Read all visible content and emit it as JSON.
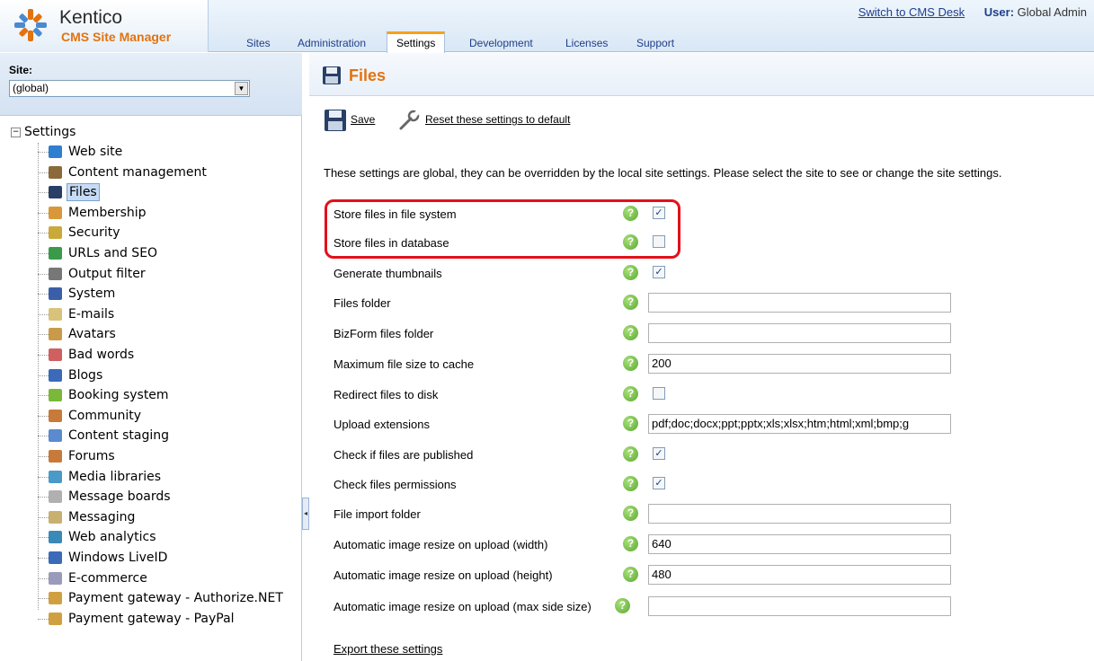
{
  "header": {
    "logo_title": "Kentico",
    "logo_subtitle": "CMS Site Manager",
    "switch_link": "Switch to CMS Desk",
    "user_label": "User:",
    "user_name": "Global Admin",
    "tabs": [
      {
        "label": "Sites"
      },
      {
        "label": "Administration"
      },
      {
        "label": "Settings"
      },
      {
        "label": "Development"
      },
      {
        "label": "Licenses"
      },
      {
        "label": "Support"
      }
    ],
    "active_tab": "Settings"
  },
  "site_selector": {
    "label": "Site:",
    "value": "(global)"
  },
  "tree": {
    "root": "Settings",
    "items": [
      {
        "label": "Web site",
        "icon": "globe-icon",
        "color": "#2f7fd0"
      },
      {
        "label": "Content management",
        "icon": "pen-icon",
        "color": "#8a6a3a"
      },
      {
        "label": "Files",
        "icon": "floppy-disk-icon",
        "color": "#2a3f66"
      },
      {
        "label": "Membership",
        "icon": "user-icon",
        "color": "#d8983a"
      },
      {
        "label": "Security",
        "icon": "key-icon",
        "color": "#c9a93a"
      },
      {
        "label": "URLs and SEO",
        "icon": "network-icon",
        "color": "#3a9a4a"
      },
      {
        "label": "Output filter",
        "icon": "filter-icon",
        "color": "#777777"
      },
      {
        "label": "System",
        "icon": "computer-icon",
        "color": "#3a5fa8"
      },
      {
        "label": "E-mails",
        "icon": "envelope-icon",
        "color": "#d9c27a"
      },
      {
        "label": "Avatars",
        "icon": "avatar-icon",
        "color": "#c89a4a"
      },
      {
        "label": "Bad words",
        "icon": "forbidden-icon",
        "color": "#d06060"
      },
      {
        "label": "Blogs",
        "icon": "book-icon",
        "color": "#3a6ab8"
      },
      {
        "label": "Booking system",
        "icon": "calendar-icon",
        "color": "#7ab83a"
      },
      {
        "label": "Community",
        "icon": "group-icon",
        "color": "#c87a3a"
      },
      {
        "label": "Content staging",
        "icon": "staging-icon",
        "color": "#5a8ad0"
      },
      {
        "label": "Forums",
        "icon": "forum-icon",
        "color": "#c87a3a"
      },
      {
        "label": "Media libraries",
        "icon": "media-icon",
        "color": "#4a9ac8"
      },
      {
        "label": "Message boards",
        "icon": "board-icon",
        "color": "#b0b0b0"
      },
      {
        "label": "Messaging",
        "icon": "envelope-icon",
        "color": "#c8b070"
      },
      {
        "label": "Web analytics",
        "icon": "analytics-icon",
        "color": "#3a8ab8"
      },
      {
        "label": "Windows LiveID",
        "icon": "liveid-icon",
        "color": "#3a6ab8"
      },
      {
        "label": "E-commerce",
        "icon": "cart-icon",
        "color": "#9a9aba"
      },
      {
        "label": "Payment gateway - Authorize.NET",
        "icon": "card-icon",
        "color": "#d0a040"
      },
      {
        "label": "Payment gateway - PayPal",
        "icon": "card-icon",
        "color": "#d0a040"
      }
    ],
    "selected": "Files"
  },
  "page": {
    "title": "Files",
    "save_label": "Save",
    "reset_label": "Reset these settings to default",
    "info_text": "These settings are global, they can be overridden by the local site settings. Please select the site to see or change the site settings.",
    "export_label": "Export these settings",
    "help_glyph": "?",
    "check_glyph": "✓"
  },
  "settings": [
    {
      "label": "Store files in file system",
      "type": "checkbox",
      "checked": true
    },
    {
      "label": "Store files in database",
      "type": "checkbox",
      "checked": false
    },
    {
      "label": "Generate thumbnails",
      "type": "checkbox",
      "checked": true
    },
    {
      "label": "Files folder",
      "type": "text",
      "value": ""
    },
    {
      "label": "BizForm files folder",
      "type": "text",
      "value": ""
    },
    {
      "label": "Maximum file size to cache",
      "type": "text",
      "value": "200"
    },
    {
      "label": "Redirect files to disk",
      "type": "checkbox",
      "checked": false
    },
    {
      "label": "Upload extensions",
      "type": "text",
      "value": "pdf;doc;docx;ppt;pptx;xls;xlsx;htm;html;xml;bmp;g"
    },
    {
      "label": "Check if files are published",
      "type": "checkbox",
      "checked": true
    },
    {
      "label": "Check files permissions",
      "type": "checkbox",
      "checked": true
    },
    {
      "label": "File import folder",
      "type": "text",
      "value": ""
    },
    {
      "label": "Automatic image resize on upload (width)",
      "type": "text",
      "value": "640"
    },
    {
      "label": "Automatic image resize on upload (height)",
      "type": "text",
      "value": "480"
    },
    {
      "label": "Automatic image resize on upload (max side size)",
      "type": "text",
      "value": ""
    }
  ],
  "colors": {
    "accent_orange": "#e2730f",
    "link_blue": "#1e3f8a",
    "highlight_red": "#e3101a"
  }
}
